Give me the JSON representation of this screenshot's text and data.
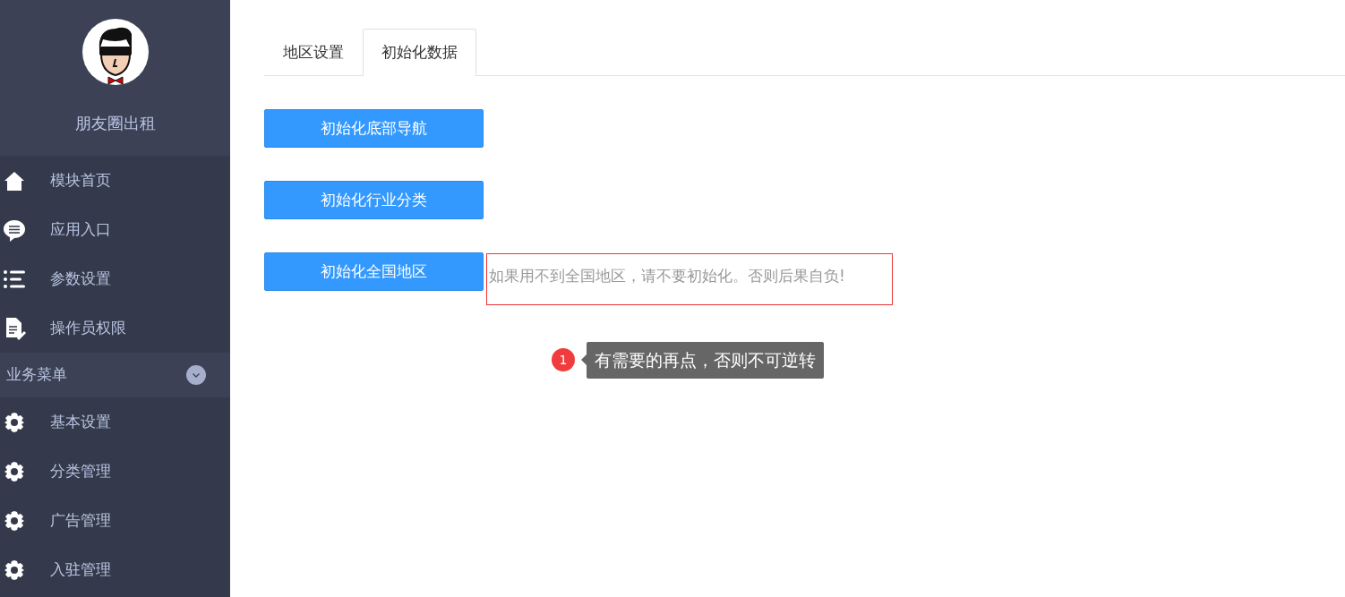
{
  "sidebar": {
    "app_name": "朋友圈出租",
    "menu": [
      {
        "label": "模块首页",
        "kind": "home"
      },
      {
        "label": "应用入口",
        "kind": "chat"
      },
      {
        "label": "参数设置",
        "kind": "list"
      },
      {
        "label": "操作员权限",
        "kind": "doc"
      }
    ],
    "group": {
      "label": "业务菜单",
      "items": [
        {
          "label": "基本设置",
          "kind": "gear"
        },
        {
          "label": "分类管理",
          "kind": "gear"
        },
        {
          "label": "广告管理",
          "kind": "gear"
        },
        {
          "label": "入驻管理",
          "kind": "gear"
        }
      ]
    }
  },
  "tabs": [
    {
      "label": "地区设置",
      "selected": false
    },
    {
      "label": "初始化数据",
      "selected": true
    }
  ],
  "buttons": [
    "初始化底部导航",
    "初始化行业分类",
    "初始化全国地区"
  ],
  "note": "如果用不到全国地区，请不要初始化。否则后果自负!",
  "tooltip": {
    "badge": "1",
    "text": "有需要的再点，否则不可逆转"
  }
}
